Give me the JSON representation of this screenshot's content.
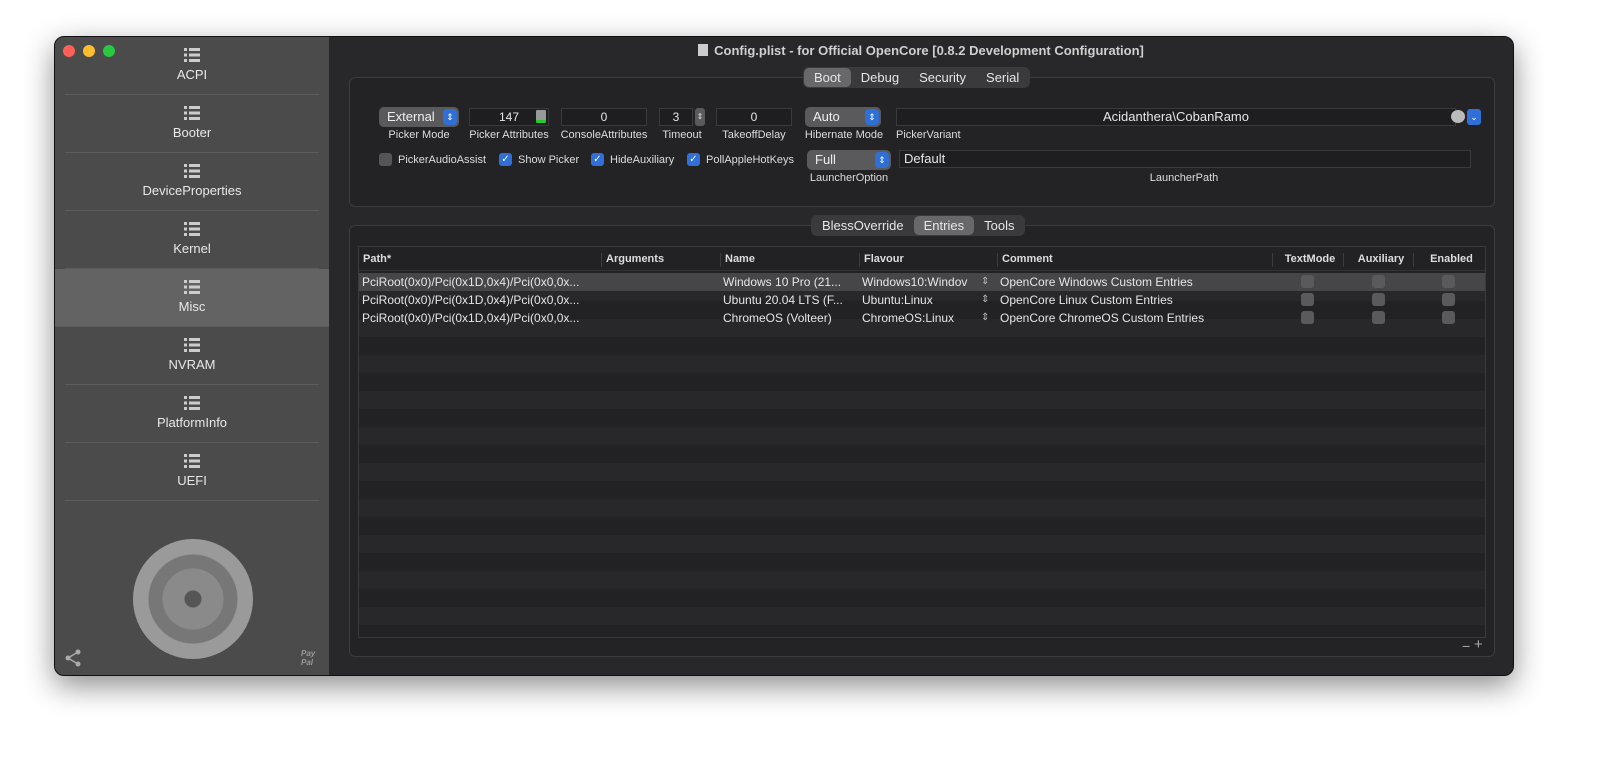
{
  "window": {
    "title": "Config.plist - for Official OpenCore [0.8.2 Development Configuration]"
  },
  "sidebar": {
    "items": [
      {
        "label": "ACPI"
      },
      {
        "label": "Booter"
      },
      {
        "label": "DeviceProperties"
      },
      {
        "label": "Kernel"
      },
      {
        "label": "Misc",
        "selected": true
      },
      {
        "label": "NVRAM"
      },
      {
        "label": "PlatformInfo"
      },
      {
        "label": "UEFI"
      }
    ],
    "paypal": "Pay Pal"
  },
  "top_tabs": [
    "Boot",
    "Debug",
    "Security",
    "Serial"
  ],
  "boot": {
    "picker_mode": {
      "value": "External",
      "label": "Picker Mode"
    },
    "picker_attributes": {
      "value": "147",
      "label": "Picker Attributes"
    },
    "console_attributes": {
      "value": "0",
      "label": "ConsoleAttributes"
    },
    "timeout": {
      "value": "3",
      "label": "Timeout"
    },
    "takeoff_delay": {
      "value": "0",
      "label": "TakeoffDelay"
    },
    "hibernate_mode": {
      "value": "Auto",
      "label": "Hibernate Mode"
    },
    "picker_variant": {
      "value": "Acidanthera\\CobanRamo",
      "label": "PickerVariant"
    },
    "launcher_option": {
      "value": "Full",
      "label": "LauncherOption"
    },
    "launcher_path": {
      "value": "Default",
      "label": "LauncherPath"
    },
    "checks": [
      {
        "label": "PickerAudioAssist",
        "checked": false
      },
      {
        "label": "Show Picker",
        "checked": true
      },
      {
        "label": "HideAuxiliary",
        "checked": true
      },
      {
        "label": "PollAppleHotKeys",
        "checked": true
      }
    ]
  },
  "sub_tabs": [
    "BlessOverride",
    "Entries",
    "Tools"
  ],
  "table": {
    "columns": [
      "Path*",
      "Arguments",
      "Name",
      "Flavour",
      "Comment",
      "TextMode",
      "Auxiliary",
      "Enabled"
    ],
    "rows": [
      {
        "path": "PciRoot(0x0)/Pci(0x1D,0x4)/Pci(0x0,0x...",
        "arguments": "",
        "name": "Windows 10 Pro (21...",
        "flavour": "Windows10:Windov",
        "comment": "OpenCore Windows Custom Entries"
      },
      {
        "path": "PciRoot(0x0)/Pci(0x1D,0x4)/Pci(0x0,0x...",
        "arguments": "",
        "name": "Ubuntu 20.04 LTS (F...",
        "flavour": "Ubuntu:Linux",
        "comment": "OpenCore Linux Custom Entries"
      },
      {
        "path": "PciRoot(0x0)/Pci(0x1D,0x4)/Pci(0x0,0x...",
        "arguments": "",
        "name": "ChromeOS (Volteer)",
        "flavour": "ChromeOS:Linux",
        "comment": "OpenCore ChromeOS Custom Entries"
      }
    ],
    "remove": "−",
    "add": "+"
  },
  "colors": {
    "accent": "#2f6fd6",
    "close": "#ff5f57",
    "minimize": "#febc2e",
    "zoom": "#28c840"
  }
}
